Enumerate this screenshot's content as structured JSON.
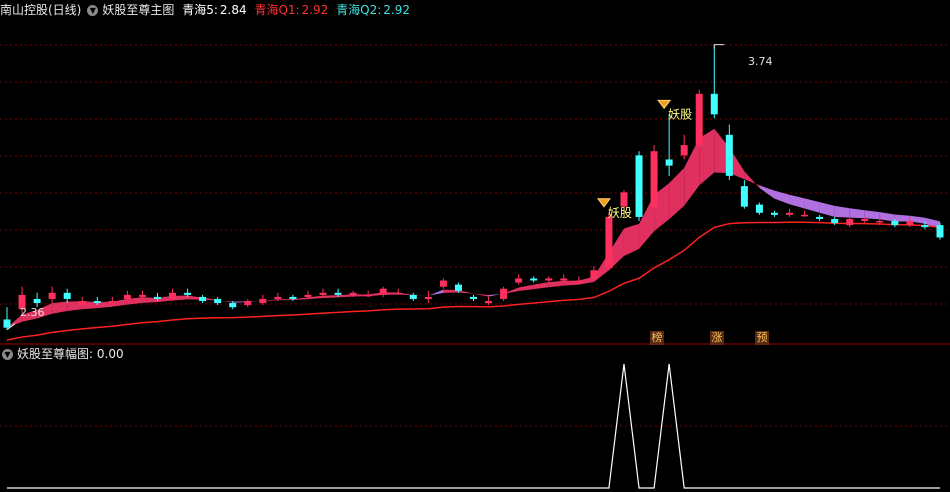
{
  "header_main": {
    "stock_label": "南山控股(日线)",
    "indicator_name": "妖股至尊主图",
    "qh5_label": "青海5:",
    "qh5_value": "2.84",
    "q1_label": "青海Q1:",
    "q1_value": "2.92",
    "q2_label": "青海Q2:",
    "q2_value": "2.92"
  },
  "header_sub": {
    "indicator_name": "妖股至尊幅图",
    "value": ": 0.00"
  },
  "colors": {
    "up": "#ff3060",
    "down": "#40ffff",
    "ma_red": "#ff2020",
    "ribbon_up": "#e03060",
    "ribbon_down": "#b070e0",
    "signal_text": "#ffff80",
    "grid": "#7a0000",
    "line_white": "#ffffff"
  },
  "annotations": {
    "high_label": "3.74",
    "low_label": "2.36",
    "signal_text": "妖股"
  },
  "tags": [
    "榜",
    "涨",
    "预"
  ],
  "chart_data": [
    {
      "type": "candlestick",
      "title": "妖股至尊主图",
      "ylim": [
        2.3,
        3.85
      ],
      "candles": [
        [
          2.4,
          2.36,
          2.46,
          2.35
        ],
        [
          2.45,
          2.52,
          2.56,
          2.43
        ],
        [
          2.5,
          2.48,
          2.53,
          2.46
        ],
        [
          2.5,
          2.53,
          2.56,
          2.48
        ],
        [
          2.53,
          2.5,
          2.55,
          2.48
        ],
        [
          2.47,
          2.49,
          2.51,
          2.46
        ],
        [
          2.49,
          2.48,
          2.51,
          2.47
        ],
        [
          2.48,
          2.49,
          2.51,
          2.47
        ],
        [
          2.5,
          2.52,
          2.54,
          2.49
        ],
        [
          2.51,
          2.52,
          2.54,
          2.5
        ],
        [
          2.51,
          2.5,
          2.53,
          2.49
        ],
        [
          2.5,
          2.53,
          2.55,
          2.49
        ],
        [
          2.53,
          2.52,
          2.55,
          2.51
        ],
        [
          2.51,
          2.49,
          2.52,
          2.48
        ],
        [
          2.5,
          2.48,
          2.51,
          2.47
        ],
        [
          2.48,
          2.46,
          2.49,
          2.45
        ],
        [
          2.47,
          2.49,
          2.5,
          2.46
        ],
        [
          2.48,
          2.5,
          2.52,
          2.47
        ],
        [
          2.5,
          2.51,
          2.53,
          2.49
        ],
        [
          2.51,
          2.5,
          2.52,
          2.49
        ],
        [
          2.51,
          2.52,
          2.54,
          2.5
        ],
        [
          2.52,
          2.53,
          2.55,
          2.51
        ],
        [
          2.53,
          2.52,
          2.55,
          2.51
        ],
        [
          2.52,
          2.53,
          2.54,
          2.51
        ],
        [
          2.52,
          2.52,
          2.54,
          2.51
        ],
        [
          2.52,
          2.55,
          2.56,
          2.51
        ],
        [
          2.53,
          2.53,
          2.55,
          2.52
        ],
        [
          2.52,
          2.5,
          2.53,
          2.49
        ],
        [
          2.5,
          2.51,
          2.54,
          2.48
        ],
        [
          2.56,
          2.59,
          2.6,
          2.55
        ],
        [
          2.57,
          2.54,
          2.58,
          2.53
        ],
        [
          2.51,
          2.5,
          2.52,
          2.49
        ],
        [
          2.48,
          2.49,
          2.51,
          2.47
        ],
        [
          2.5,
          2.55,
          2.56,
          2.49
        ],
        [
          2.58,
          2.6,
          2.62,
          2.57
        ],
        [
          2.6,
          2.59,
          2.61,
          2.58
        ],
        [
          2.59,
          2.6,
          2.61,
          2.58
        ],
        [
          2.59,
          2.6,
          2.62,
          2.58
        ],
        [
          2.58,
          2.59,
          2.61,
          2.57
        ],
        [
          2.6,
          2.64,
          2.66,
          2.59
        ],
        [
          2.65,
          2.9,
          2.92,
          2.64
        ],
        [
          2.95,
          3.02,
          3.03,
          2.94
        ],
        [
          3.2,
          2.9,
          3.22,
          2.88
        ],
        [
          2.95,
          3.22,
          3.25,
          2.94
        ],
        [
          3.18,
          3.15,
          3.4,
          3.1
        ],
        [
          3.2,
          3.25,
          3.3,
          3.18
        ],
        [
          3.25,
          3.5,
          3.52,
          3.24
        ],
        [
          3.5,
          3.4,
          3.74,
          3.38
        ],
        [
          3.3,
          3.1,
          3.35,
          3.08
        ],
        [
          3.05,
          2.95,
          3.08,
          2.94
        ],
        [
          2.96,
          2.92,
          2.97,
          2.91
        ],
        [
          2.92,
          2.91,
          2.93,
          2.9
        ],
        [
          2.91,
          2.92,
          2.94,
          2.9
        ],
        [
          2.91,
          2.91,
          2.93,
          2.9
        ],
        [
          2.9,
          2.89,
          2.91,
          2.88
        ],
        [
          2.89,
          2.87,
          2.9,
          2.86
        ],
        [
          2.86,
          2.89,
          2.91,
          2.85
        ],
        [
          2.88,
          2.89,
          2.9,
          2.87
        ],
        [
          2.88,
          2.88,
          2.9,
          2.86
        ],
        [
          2.88,
          2.86,
          2.89,
          2.85
        ],
        [
          2.86,
          2.88,
          2.9,
          2.85
        ],
        [
          2.86,
          2.85,
          2.88,
          2.84
        ],
        [
          2.86,
          2.8,
          2.87,
          2.79
        ]
      ]
    },
    {
      "type": "line",
      "title": "妖股至尊幅图",
      "ylim": [
        0,
        1
      ],
      "values": [
        0,
        0,
        0,
        0,
        0,
        0,
        0,
        0,
        0,
        0,
        0,
        0,
        0,
        0,
        0,
        0,
        0,
        0,
        0,
        0,
        0,
        0,
        0,
        0,
        0,
        0,
        0,
        0,
        0,
        0,
        0,
        0,
        0,
        0,
        0,
        0,
        0,
        0,
        0,
        0,
        0,
        1,
        0,
        0,
        1,
        0,
        0,
        0,
        0,
        0,
        0,
        0,
        0,
        0,
        0,
        0,
        0,
        0,
        0,
        0,
        0,
        0,
        0
      ]
    }
  ]
}
